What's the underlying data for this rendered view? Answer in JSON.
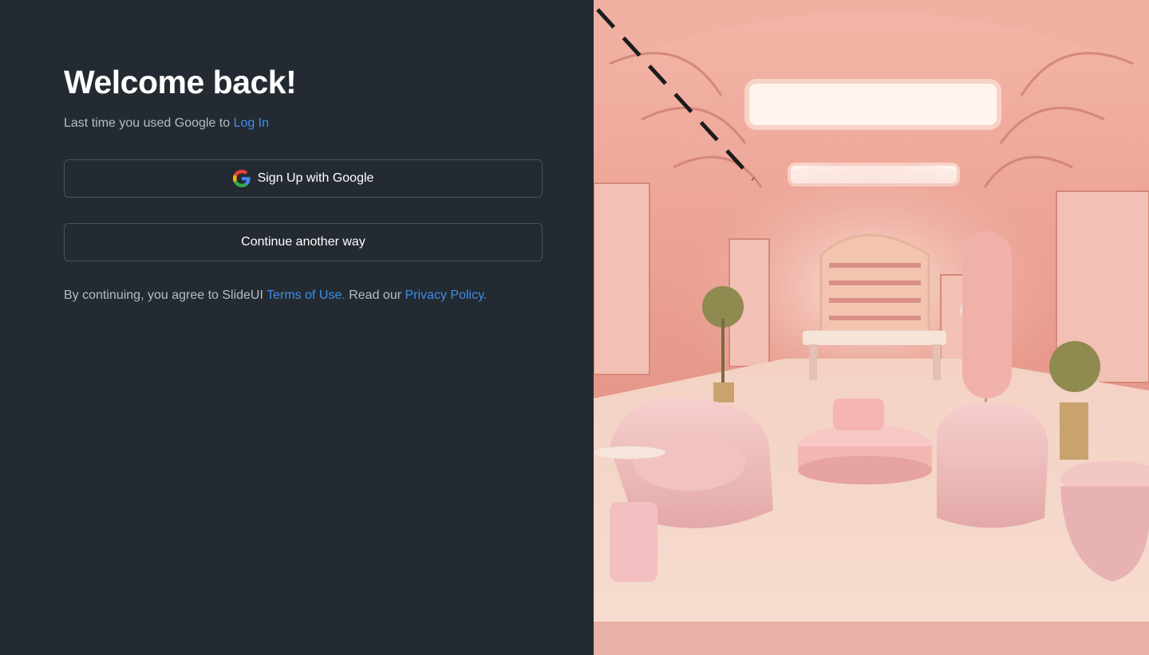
{
  "heading": "Welcome back!",
  "last_used": {
    "prefix": "Last time you used Google to ",
    "link": "Log In"
  },
  "buttons": {
    "google_label": "Sign Up with Google",
    "other_label": "Continue another way"
  },
  "terms": {
    "prefix": "By continuing, you agree to SlideUI ",
    "terms_link": "Terms of Use.",
    "middle": " Read our ",
    "privacy_link": "Privacy Policy."
  },
  "icons": {
    "google": "google-icon"
  },
  "colors": {
    "background": "#242a32",
    "link": "#3d8fe6",
    "button_border": "#4a515b",
    "muted_text": "#b7bcc4"
  }
}
